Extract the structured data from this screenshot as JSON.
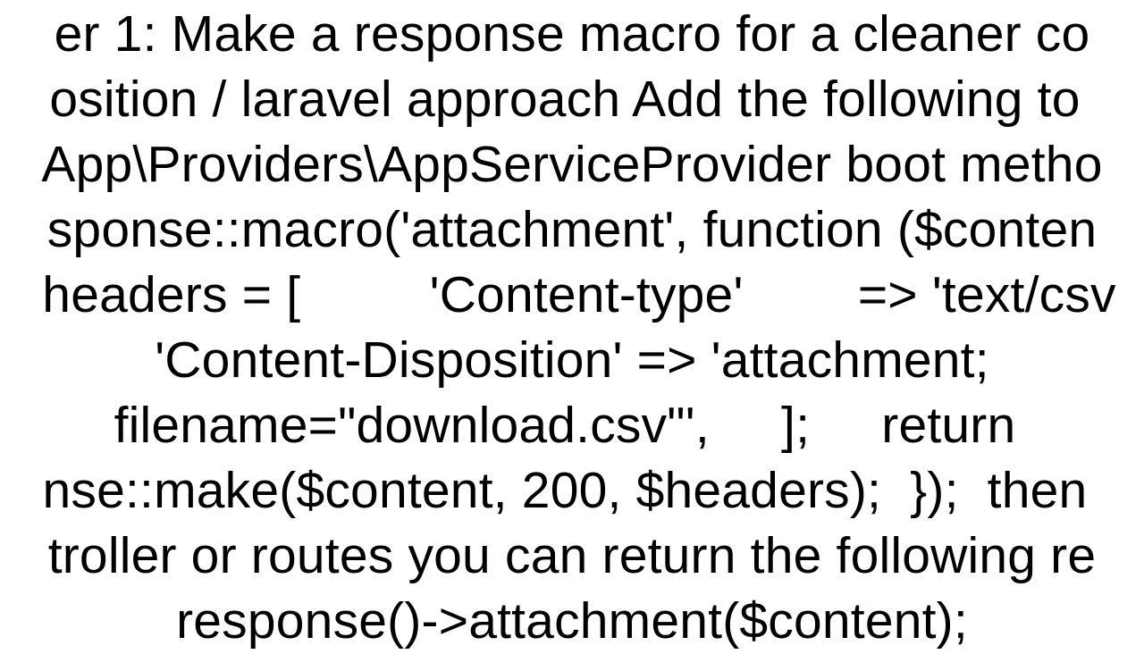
{
  "document": {
    "text": "er 1: Make a response macro for a cleaner co\nosition / laravel approach Add the following to \nApp\\Providers\\AppServiceProvider boot metho\nsponse::macro('attachment', function ($conten\n headers = [         'Content-type'        => 'text/csv\n'Content-Disposition' => 'attachment; filename=\"download.csv\"',     ];     return \nnse::make($content, 200, $headers);  });  then \ntroller or routes you can return the following re\nresponse()->attachment($content);"
  }
}
